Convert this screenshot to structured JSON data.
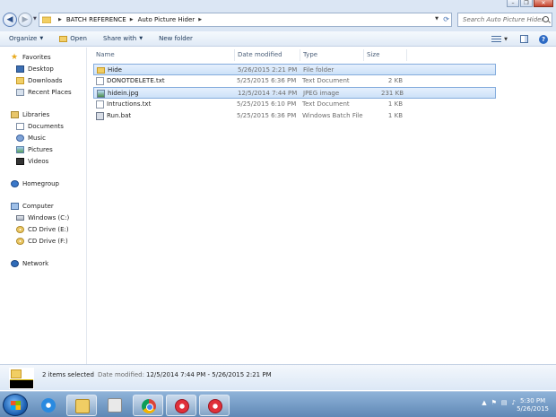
{
  "window": {
    "minimize": "–",
    "maximize": "❐",
    "close": "✕"
  },
  "address": {
    "crumbs": [
      "BATCH REFERENCE",
      "Auto Picture Hider"
    ],
    "search_placeholder": "Search Auto Picture Hider"
  },
  "toolbar": {
    "organize": "Organize",
    "open": "Open",
    "share_with": "Share with",
    "new_folder": "New folder",
    "help": "?"
  },
  "nav": {
    "favorites": "Favorites",
    "desktop": "Desktop",
    "downloads": "Downloads",
    "recent_places": "Recent Places",
    "libraries": "Libraries",
    "documents": "Documents",
    "music": "Music",
    "pictures": "Pictures",
    "videos": "Videos",
    "homegroup": "Homegroup",
    "computer": "Computer",
    "windows_c": "Windows (C:)",
    "cd_e": "CD Drive (E:)",
    "cd_f": "CD Drive (F:)",
    "network": "Network"
  },
  "columns": {
    "name": "Name",
    "date": "Date modified",
    "type": "Type",
    "size": "Size"
  },
  "files": [
    {
      "name": "Hide",
      "date": "5/26/2015 2:21 PM",
      "type": "File folder",
      "size": "",
      "icon": "folder-icon",
      "selected": true
    },
    {
      "name": "DONOTDELETE.txt",
      "date": "5/25/2015 6:36 PM",
      "type": "Text Document",
      "size": "2 KB",
      "icon": "text-file-icon",
      "selected": false
    },
    {
      "name": "hidein.jpg",
      "date": "12/5/2014 7:44 PM",
      "type": "JPEG image",
      "size": "231 KB",
      "icon": "image-file-icon",
      "selected": true
    },
    {
      "name": "Intructions.txt",
      "date": "5/25/2015 6:10 PM",
      "type": "Text Document",
      "size": "1 KB",
      "icon": "text-file-icon",
      "selected": false
    },
    {
      "name": "Run.bat",
      "date": "5/25/2015 6:36 PM",
      "type": "Windows Batch File",
      "size": "1 KB",
      "icon": "batch-file-icon",
      "selected": false
    }
  ],
  "details": {
    "selected_count": "2 items selected",
    "date_label": "Date modified:",
    "date_value": "12/5/2014 7:44 PM - 5/26/2015 2:21 PM"
  },
  "taskbar": {
    "time": "5:30 PM",
    "date": "5/26/2015",
    "tray_arrow": "▲"
  }
}
